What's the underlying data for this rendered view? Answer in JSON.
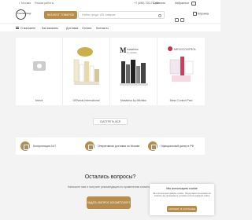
{
  "topbar": {
    "city": "г. Москва",
    "work": "Режим работы",
    "phone": "+7 (495) 720-71-93",
    "compare": "Сравнить",
    "favorites": "Избранное"
  },
  "header": {
    "logo": "Cosmetology",
    "catalog": "КАТАЛОГ ТОВАРОВ",
    "search_placeholder": "Найти среди 150 товаров",
    "cart": "Корзина"
  },
  "nav": {
    "items": [
      "О магазине",
      "Как заказать",
      "Доставка",
      "Оплата",
      "Контакты"
    ]
  },
  "brands": [
    {
      "name": "Astroil"
    },
    {
      "name": "GENesis International"
    },
    {
      "name": "Masahisa by Mikihiko"
    },
    {
      "name": "Meso Control Peel"
    }
  ],
  "all_button": "СМОТРЕТЬ ВСЕ",
  "features": [
    {
      "label": "Консультация 24/7"
    },
    {
      "label": "Оперативная доставка по Москве"
    },
    {
      "label": "Официальный дилер в РФ"
    }
  ],
  "questions": {
    "title": "Остались вопросы?",
    "text": "Напишите нам и получите рекомендацию по применению косметики",
    "button": "ЗАДАТЬ ВОПРОС КОСМЕТОЛОГУ"
  },
  "cookie": {
    "title": "Мы используем cookie",
    "text": "Мы используем файлы cookie. Продолжая пользоваться сайтом, вы принимаете условия использования сайта",
    "button": "ХОРОШО, Я СОГЛАСЕН"
  },
  "colors": {
    "accent": "#b88c4a"
  }
}
